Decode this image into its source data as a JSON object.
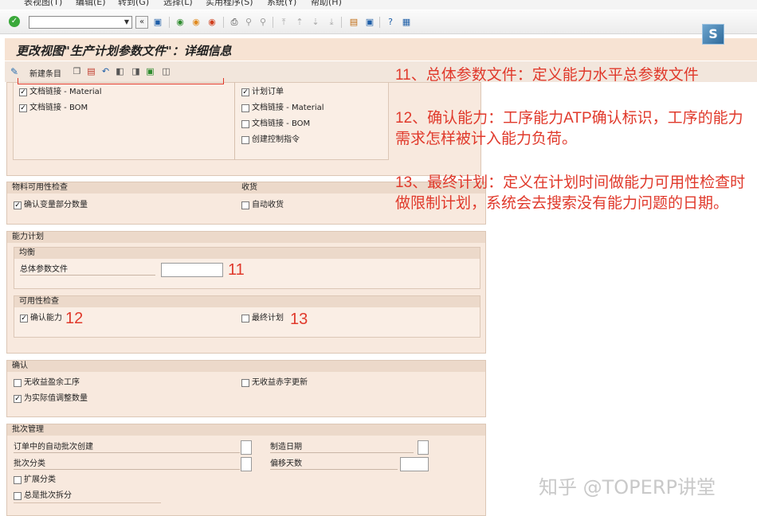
{
  "menu": [
    "表视图(T)",
    "编辑(E)",
    "转到(G)",
    "选择(L)",
    "实用程序(S)",
    "系统(Y)",
    "帮助(H)"
  ],
  "toolbar": {
    "check_icon": "check-icon",
    "command_value": "",
    "icons": [
      "back-icon",
      "save-icon",
      "back-green-icon",
      "exit-icon",
      "cancel-icon",
      "print-icon",
      "find-icon",
      "find-next-icon",
      "first-page-icon",
      "prev-page-icon",
      "next-page-icon",
      "last-page-icon",
      "new-session-icon",
      "shortcut-icon",
      "help-icon",
      "layout-icon"
    ]
  },
  "title": "更改视图\"生产计划参数文件\"：详细信息",
  "app_toolbar": {
    "new_entries": "新建条目",
    "icons": [
      "copy-icon",
      "delete-icon",
      "undo-icon",
      "previous-entry-icon",
      "next-entry-icon",
      "select-icon",
      "other-icon"
    ]
  },
  "doc_links": {
    "left": [
      {
        "label": "文档链接 - Material",
        "checked": true
      },
      {
        "label": "文档链接 - BOM",
        "checked": true
      }
    ],
    "right": [
      {
        "label": "计划订单",
        "checked": true
      },
      {
        "label": "文档链接 - Material",
        "checked": false
      },
      {
        "label": "文档链接 - BOM",
        "checked": false
      },
      {
        "label": "创建控制指令",
        "checked": false
      }
    ]
  },
  "material_availability": {
    "header": "物料可用性检查",
    "confirm_variant": {
      "label": "确认变量部分数量",
      "checked": true
    }
  },
  "goods_receipt": {
    "header": "收货",
    "auto_gr": {
      "label": "自动收货",
      "checked": false
    }
  },
  "capacity_planning": {
    "header": "能力计划",
    "leveling_header": "均衡",
    "overall_profile_label": "总体参数文件",
    "overall_profile_value": "",
    "availability_header": "可用性检查",
    "confirm_capacity": {
      "label": "确认能力",
      "checked": true
    },
    "finite_scheduling": {
      "label": "最终计划",
      "checked": false
    }
  },
  "confirmation": {
    "header": "确认",
    "no_surplus_ops": {
      "label": "无收益盈余工序",
      "checked": false
    },
    "no_red_update": {
      "label": "无收益赤字更新",
      "checked": false
    },
    "adjust_actual": {
      "label": "为实际值调整数量",
      "checked": true
    }
  },
  "batch_management": {
    "header": "批次管理",
    "auto_batch_label": "订单中的自动批次创建",
    "batch_class_label": "批次分类",
    "mfg_date_label": "制造日期",
    "offset_days_label": "偏移天数",
    "ext_class": {
      "label": "扩展分类",
      "checked": false
    },
    "always_split": {
      "label": "总是批次拆分",
      "checked": false
    }
  },
  "markers": {
    "n11": "11",
    "n12": "12",
    "n13": "13"
  },
  "notes": {
    "note11": "11、总体参数文件：定义能力水平总参数文件",
    "note12": "12、确认能力：工序能力ATP确认标识，工序的能力需求怎样被计入能力负荷。",
    "note13": "13、最终计划：定义在计划时间做能力可用性检查时做限制计划，系统会去搜索没有能力问题的日期。"
  },
  "watermark": "知乎 @TOPERP讲堂",
  "colors": {
    "annotation": "#e0392b",
    "panel": "#f8e9de",
    "title_bar": "#f7e3d3"
  }
}
